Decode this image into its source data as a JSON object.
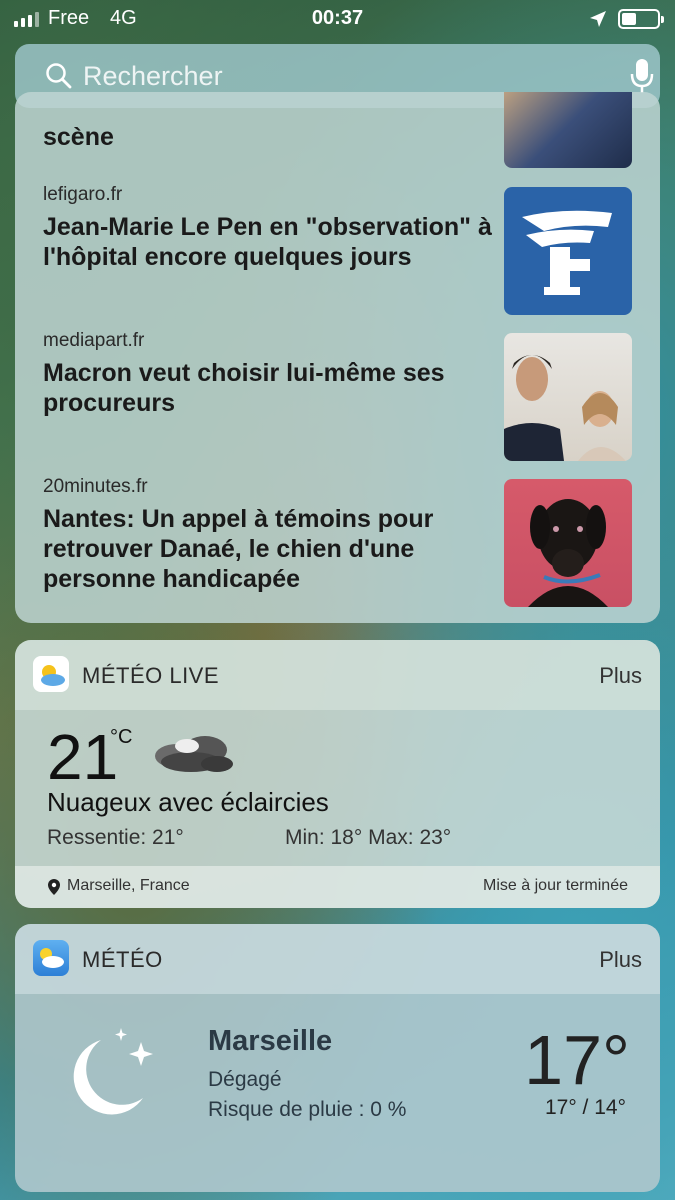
{
  "status_bar": {
    "carrier": "Free",
    "network": "4G",
    "time": "00:37"
  },
  "search": {
    "placeholder": "Rechercher"
  },
  "news": {
    "items": [
      {
        "source": "",
        "title": "scène"
      },
      {
        "source": "lefigaro.fr",
        "title": "Jean-Marie Le Pen en \"observation\" à l'hôpital encore quelques jours"
      },
      {
        "source": "mediapart.fr",
        "title": "Macron veut choisir lui-même ses procureurs"
      },
      {
        "source": "20minutes.fr",
        "title": "Nantes: Un appel à témoins pour retrouver Danaé, le chien d'une personne handicapée"
      }
    ],
    "thumb_logo_letter": "F"
  },
  "meteo_live": {
    "title": "MÉTÉO LIVE",
    "more": "Plus",
    "temperature": "21",
    "unit": "°C",
    "condition": "Nuageux avec éclaircies",
    "feels_like": "Ressentie: 21°",
    "min_max": "Min: 18° Max: 23°",
    "location": "Marseille, France",
    "updated": "Mise à jour terminée"
  },
  "meteo": {
    "title": "MÉTÉO",
    "more": "Plus",
    "city": "Marseille",
    "condition": "Dégagé",
    "rain": "Risque de pluie : 0 %",
    "temperature": "17°",
    "min_max": "17° / 14°"
  },
  "colors": {
    "figaro_blue": "#2a63a8",
    "meteo_icon_blue": "#3b8ee8"
  }
}
